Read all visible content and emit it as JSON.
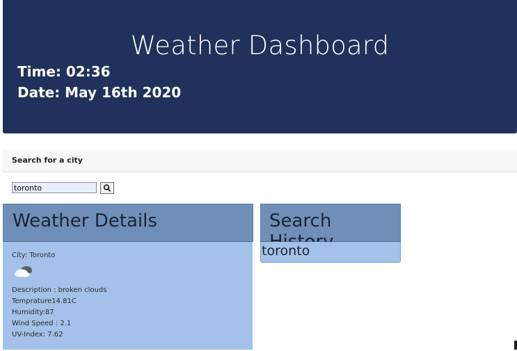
{
  "header": {
    "title": "Weather Dashboard",
    "time": "Time: 02:36",
    "date": "Date: May 16th 2020"
  },
  "search": {
    "heading": "Search for a city",
    "value": "toronto",
    "button_icon": "search-icon"
  },
  "details": {
    "heading": "Weather Details",
    "city": "City: Toronto",
    "icon": "broken-clouds-icon",
    "description": "Description : broken clouds",
    "temperature": "Temprature14.81C",
    "humidity": "Humidity:87",
    "wind": "Wind Speed : 2.1",
    "uv": "UV-Index: 7.62"
  },
  "history": {
    "heading": "Search History",
    "items": [
      "toronto"
    ]
  },
  "colors": {
    "header_bg": "#20315b",
    "panel_header_bg": "#6f8fb9",
    "panel_body_bg": "#a3c1e9"
  }
}
